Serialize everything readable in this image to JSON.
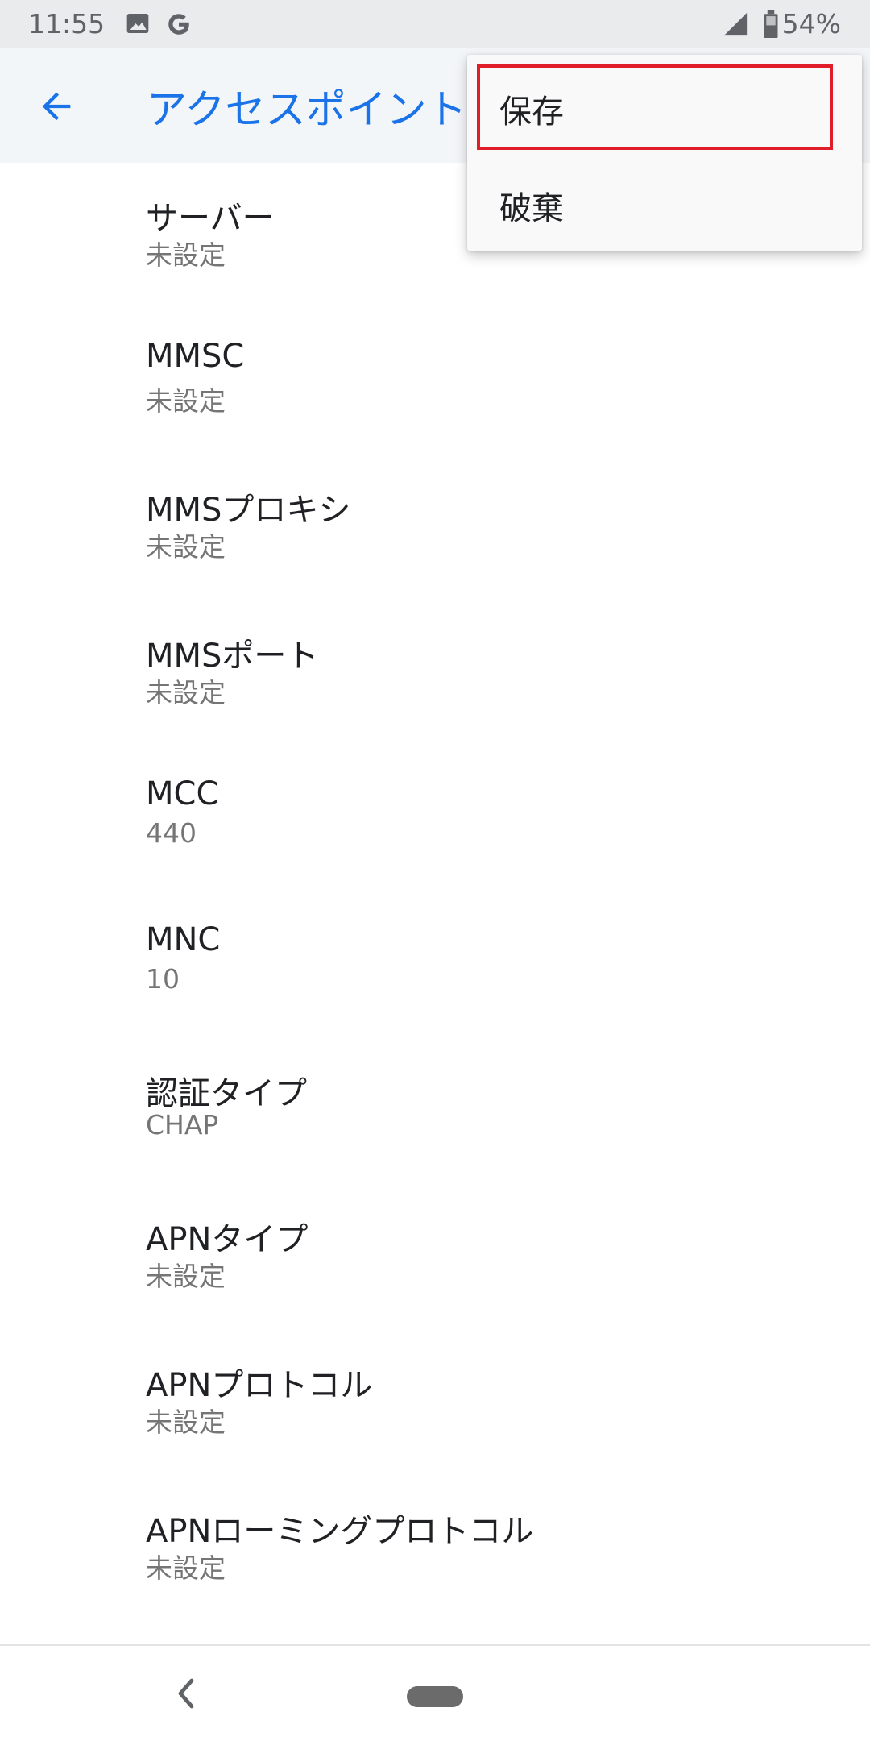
{
  "status_bar": {
    "time": "11:55",
    "icons": [
      "image-icon",
      "google-icon",
      "signal-icon",
      "battery-icon"
    ],
    "battery_percent": "54%"
  },
  "app_bar": {
    "title": "アクセスポイント",
    "back_icon": "arrow-back-icon",
    "accent_color": "#1a73e8"
  },
  "settings": [
    {
      "title": "サーバー",
      "summary": "未設定"
    },
    {
      "title": "MMSC",
      "summary": "未設定"
    },
    {
      "title": "MMSプロキシ",
      "summary": "未設定"
    },
    {
      "title": "MMSポート",
      "summary": "未設定"
    },
    {
      "title": "MCC",
      "summary": "440"
    },
    {
      "title": "MNC",
      "summary": "10"
    },
    {
      "title": "認証タイプ",
      "summary": "CHAP"
    },
    {
      "title": "APNタイプ",
      "summary": "未設定"
    },
    {
      "title": "APNプロトコル",
      "summary": "未設定"
    },
    {
      "title": "APNローミングプロトコル",
      "summary": "未設定"
    }
  ],
  "menu": {
    "items": [
      {
        "label": "保存",
        "highlighted": true
      },
      {
        "label": "破棄",
        "highlighted": false
      }
    ],
    "highlight_color": "#e01e2a"
  },
  "nav_bar": {
    "icons": [
      "nav-back-icon",
      "home-pill-icon"
    ]
  }
}
